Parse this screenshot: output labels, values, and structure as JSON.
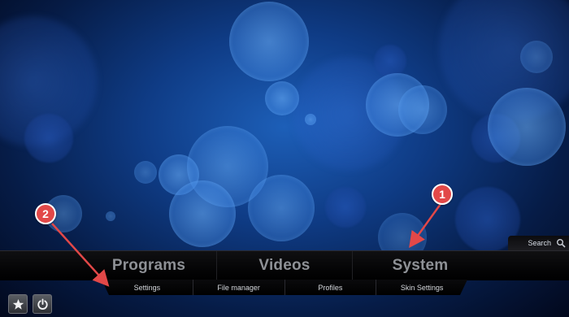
{
  "search": {
    "label": "Search",
    "icon": "search-icon"
  },
  "main_menu": {
    "items": [
      {
        "label": "Programs"
      },
      {
        "label": "Videos"
      },
      {
        "label": "System"
      }
    ]
  },
  "sub_menu": {
    "items": [
      {
        "label": "Settings"
      },
      {
        "label": "File manager"
      },
      {
        "label": "Profiles"
      },
      {
        "label": "Skin Settings"
      }
    ]
  },
  "bottom_buttons": [
    {
      "icon": "star-icon"
    },
    {
      "icon": "power-icon"
    }
  ],
  "annotations": [
    {
      "number": "1",
      "color": "#e24848"
    },
    {
      "number": "2",
      "color": "#e24848"
    }
  ]
}
